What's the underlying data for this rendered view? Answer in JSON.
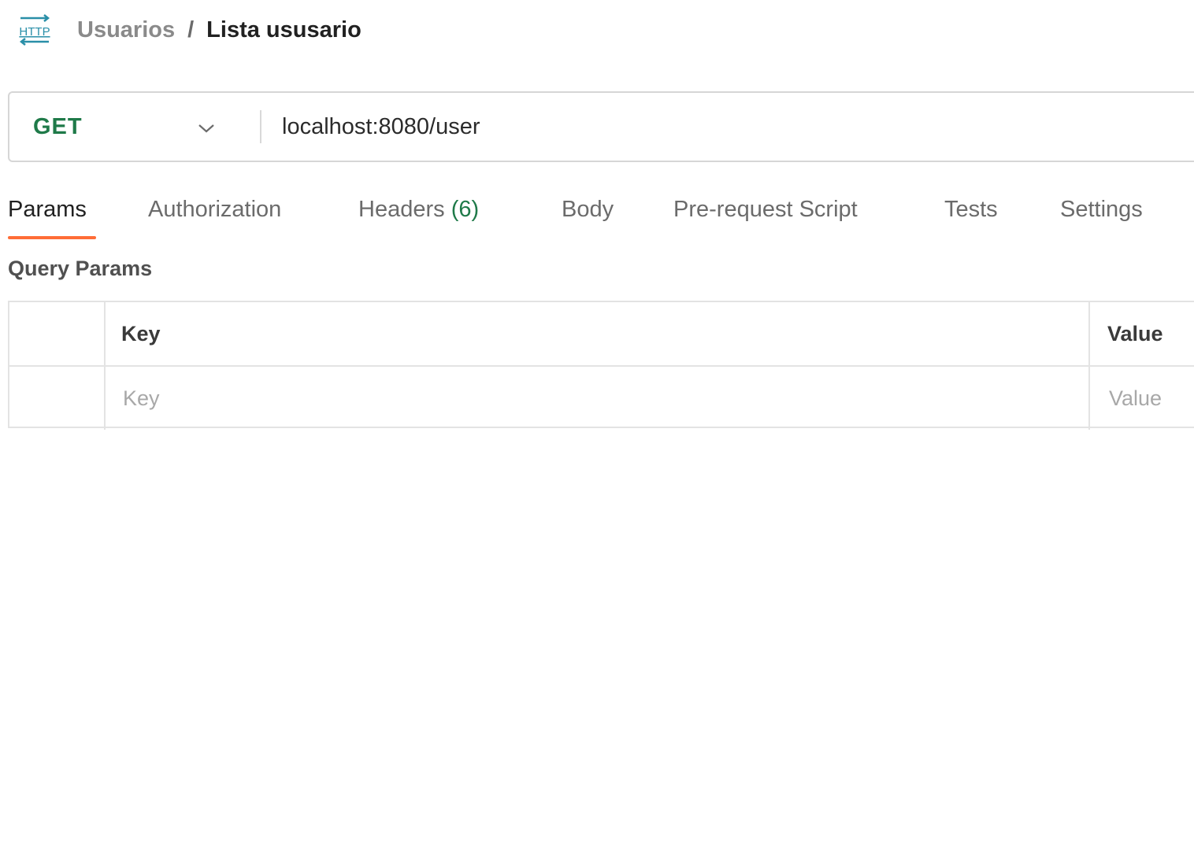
{
  "breadcrumb": {
    "icon": "http-request-icon",
    "parent": "Usuarios",
    "separator": "/",
    "current": "Lista ususario"
  },
  "request": {
    "method": "GET",
    "url": "localhost:8080/user"
  },
  "tabs": [
    {
      "label": "Params",
      "active": true
    },
    {
      "label": "Authorization"
    },
    {
      "label": "Headers",
      "count": "(6)"
    },
    {
      "label": "Body"
    },
    {
      "label": "Pre-request Script"
    },
    {
      "label": "Tests"
    },
    {
      "label": "Settings"
    }
  ],
  "query_params": {
    "title": "Query Params",
    "columns": {
      "key": "Key",
      "value": "Value"
    },
    "new_row": {
      "key_placeholder": "Key",
      "value_placeholder": "Value"
    }
  },
  "colors": {
    "method_get": "#1f7a49",
    "active_tab_indicator": "#ff6c37",
    "http_icon": "#2a8fa8"
  }
}
